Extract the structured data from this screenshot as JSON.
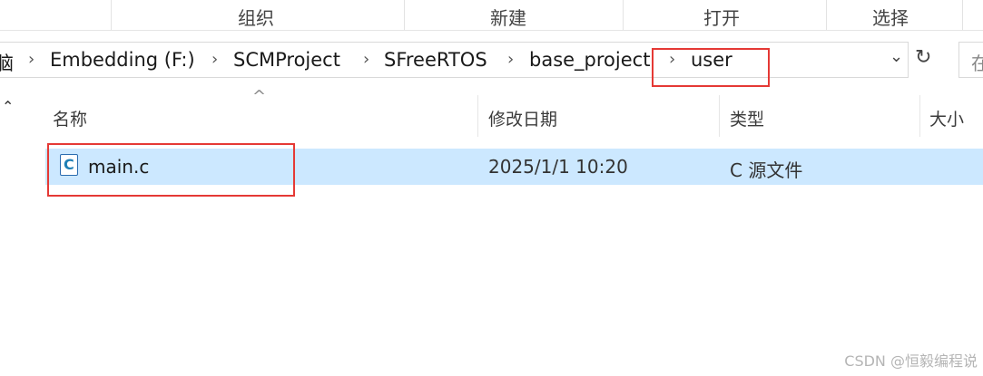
{
  "ribbon": {
    "groups": [
      "组织",
      "新建",
      "打开",
      "选择"
    ]
  },
  "address_bar": {
    "crumbs": [
      "脑",
      "Embedding (F:)",
      "SCMProject",
      "SFreeRTOS",
      "base_project",
      "user"
    ],
    "search_placeholder": "在"
  },
  "file_list": {
    "columns": [
      "名称",
      "修改日期",
      "类型",
      "大小"
    ],
    "rows": [
      {
        "name": "main.c",
        "modified": "2025/1/1 10:20",
        "type": "C 源文件",
        "size": ""
      }
    ]
  },
  "watermark": "CSDN @恒毅编程说",
  "colors": {
    "selection": "#cce8ff",
    "highlight_box": "#e53935",
    "file_icon": "#1f7fb5"
  },
  "icons": [
    "chevron-right-icon",
    "chevron-down-icon",
    "refresh-icon",
    "sort-up-icon",
    "c-file-icon"
  ]
}
